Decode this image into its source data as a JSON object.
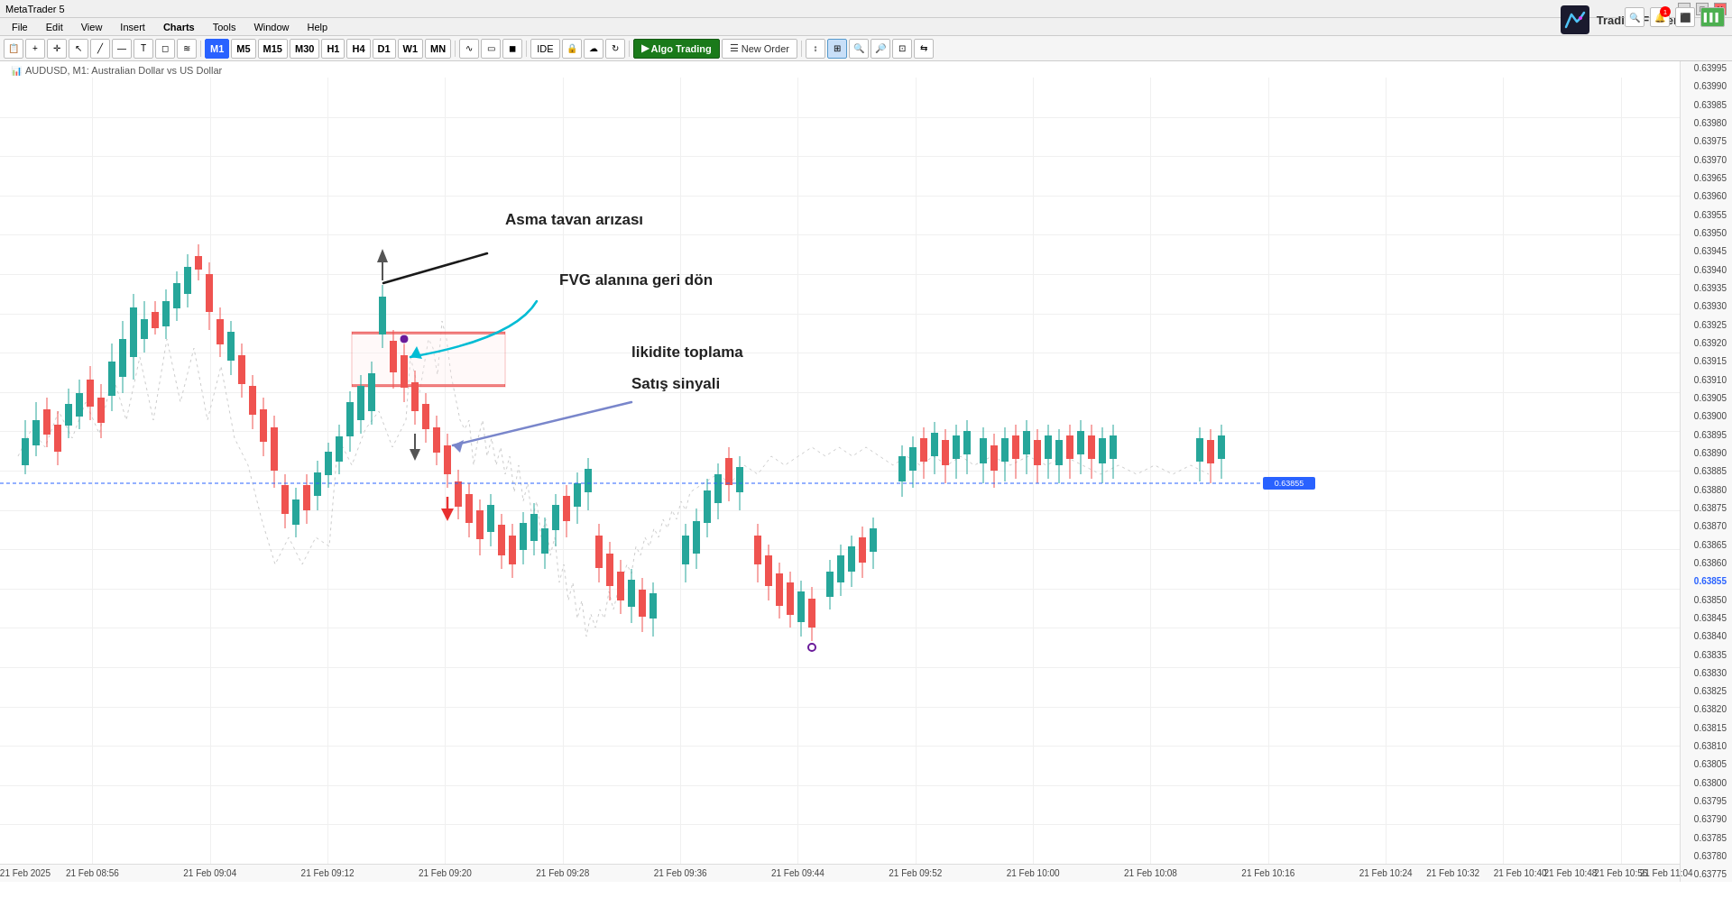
{
  "app": {
    "title": "MetaTrader 5",
    "symbol": "AUDUSD, M1: Australian Dollar vs US Dollar",
    "symbol_short": "AUDUSD",
    "timeframe": "M1"
  },
  "menu": {
    "items": [
      "File",
      "Edit",
      "View",
      "Insert",
      "Charts",
      "Tools",
      "Window",
      "Help"
    ]
  },
  "toolbar": {
    "timeframes": [
      "M1",
      "M5",
      "M15",
      "M30",
      "H1",
      "H4",
      "D1",
      "W1",
      "MN"
    ],
    "active_timeframe": "M1",
    "algo_trading": "Algo Trading",
    "new_order": "New Order",
    "ide_label": "IDE"
  },
  "brand": {
    "name": "Trading Finder"
  },
  "chart": {
    "annotations": {
      "ceiling_fault": "Asma tavan arızası",
      "fvg_return": "FVG alanına geri dön",
      "liquidity": "likidite toplama",
      "sell_signal": "Satış sinyali"
    }
  },
  "price_axis": {
    "prices": [
      "0.63995",
      "0.63990",
      "0.63985",
      "0.63980",
      "0.63975",
      "0.63970",
      "0.63965",
      "0.63960",
      "0.63955",
      "0.63950",
      "0.63945",
      "0.63940",
      "0.63935",
      "0.63930",
      "0.63925",
      "0.63920",
      "0.63915",
      "0.63910",
      "0.63905",
      "0.63900",
      "0.63895",
      "0.63890",
      "0.63885",
      "0.63880",
      "0.63875",
      "0.63870",
      "0.63865",
      "0.63860",
      "0.63855",
      "0.63850",
      "0.63845",
      "0.63840",
      "0.63835",
      "0.63830",
      "0.63825",
      "0.63820",
      "0.63815",
      "0.63810",
      "0.63805",
      "0.63800",
      "0.63795",
      "0.63790",
      "0.63785",
      "0.63780",
      "0.63775"
    ]
  },
  "time_axis": {
    "times": [
      {
        "label": "21 Feb 2025",
        "pct": 1.5
      },
      {
        "label": "21 Feb 08:56",
        "pct": 5.5
      },
      {
        "label": "21 Feb 09:04",
        "pct": 12.5
      },
      {
        "label": "21 Feb 09:12",
        "pct": 19.5
      },
      {
        "label": "21 Feb 09:20",
        "pct": 26.5
      },
      {
        "label": "21 Feb 09:28",
        "pct": 33.5
      },
      {
        "label": "21 Feb 09:36",
        "pct": 40.5
      },
      {
        "label": "21 Feb 09:44",
        "pct": 47.5
      },
      {
        "label": "21 Feb 09:52",
        "pct": 54.5
      },
      {
        "label": "21 Feb 10:00",
        "pct": 61.5
      },
      {
        "label": "21 Feb 10:08",
        "pct": 68.5
      },
      {
        "label": "21 Feb 10:16",
        "pct": 75.5
      },
      {
        "label": "21 Feb 10:24",
        "pct": 82.5
      },
      {
        "label": "21 Feb 10:32",
        "pct": 86.5
      },
      {
        "label": "21 Feb 10:40",
        "pct": 90.5
      },
      {
        "label": "21 Feb 10:48",
        "pct": 93.5
      },
      {
        "label": "21 Feb 10:56",
        "pct": 96.5
      },
      {
        "label": "21 Feb 11:04",
        "pct": 99.5
      }
    ]
  }
}
